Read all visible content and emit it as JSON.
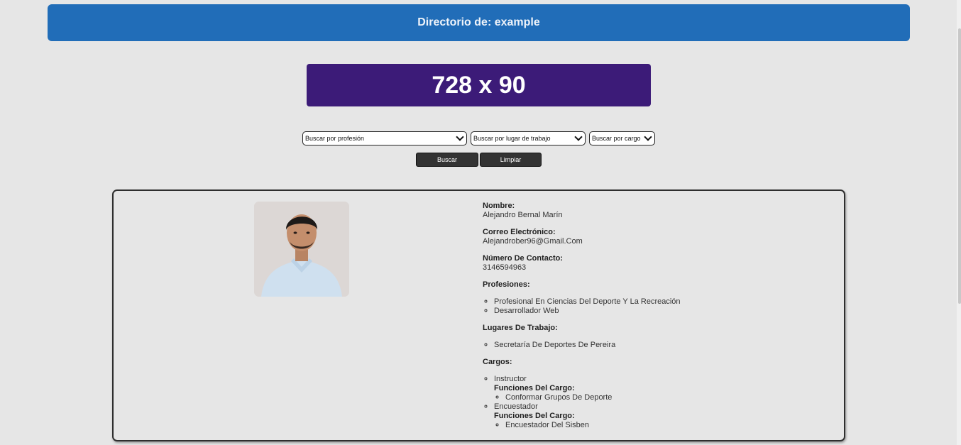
{
  "header": {
    "title": "Directorio de: example"
  },
  "ad": {
    "text": "728 x 90"
  },
  "filters": {
    "profession": "Buscar por profesión",
    "workplace": "Buscar por lugar de trabajo",
    "position": "Buscar por cargo"
  },
  "buttons": {
    "search": "Buscar",
    "clear": "Limpiar"
  },
  "person": {
    "name_label": "Nombre:",
    "name": "Alejandro Bernal Marín",
    "email_label": "Correo Electrónico:",
    "email": "Alejandrober96@Gmail.Com",
    "phone_label": "Número De Contacto:",
    "phone": "3146594963",
    "professions_label": "Profesiones:",
    "professions": [
      "Profesional En Ciencias Del Deporte Y La Recreación",
      "Desarrollador Web"
    ],
    "workplaces_label": "Lugares De Trabajo:",
    "workplaces": [
      "Secretaría De Deportes De Pereira"
    ],
    "positions_label": "Cargos:",
    "positions": [
      {
        "name": "Instructor",
        "functions_label": "Funciones Del Cargo:",
        "functions": [
          "Conformar Grupos De Deporte"
        ]
      },
      {
        "name": "Encuestador",
        "functions_label": "Funciones Del Cargo:",
        "functions": [
          "Encuestador Del Sisben"
        ]
      }
    ]
  }
}
